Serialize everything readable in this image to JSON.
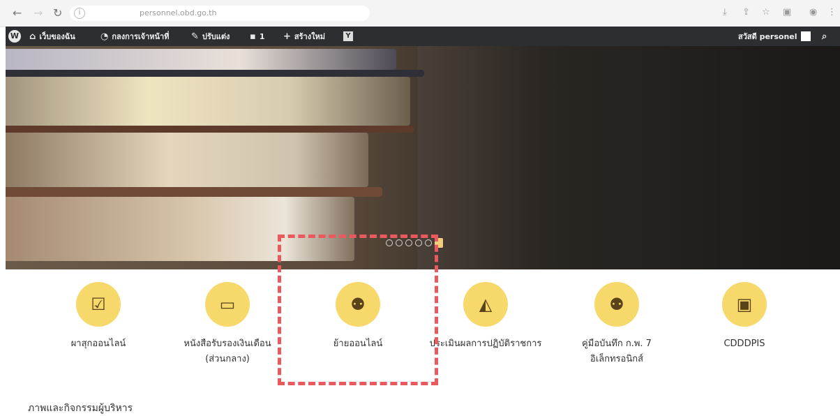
{
  "browser": {
    "url": "personnel.obd.go.th",
    "back_icon": "back-arrow-icon",
    "reload_icon": "reload-icon"
  },
  "admin_bar": {
    "my_site": "เว็บของฉัน",
    "dashboard": "กลงการเจ้าหน้าที่",
    "customize": "ปรับแต่ง",
    "comments_count": "1",
    "new_content": "สร้างใหม่",
    "greeting": "สวัสดี personel"
  },
  "slider": {
    "slide_count": 6,
    "active_index": 6
  },
  "menu": {
    "items": [
      {
        "label": "ผาสุกออนไลน์",
        "label2": "",
        "icon": "calendar-check-icon"
      },
      {
        "label": "หนังสือรับรองเงินเดือน",
        "label2": "(ส่วนกลาง)",
        "icon": "money-icon"
      },
      {
        "label": "ย้ายออนไลน์",
        "label2": "",
        "icon": "users-icon"
      },
      {
        "label": "ประเมินผลการปฏิบัติราชการ",
        "label2": "",
        "icon": "area-chart-icon"
      },
      {
        "label": "คู่มือบันทึก ก.พ. 7",
        "label2": "อิเล็กทรอนิกส์",
        "icon": "users-icon"
      },
      {
        "label": "CDDDPIS",
        "label2": "",
        "icon": "slideshare-icon"
      }
    ]
  },
  "section": {
    "title": "ภาพและกิจกรรมผู้บริหาร"
  },
  "colors": {
    "icon_circle": "#f7d86b",
    "highlight": "#e85a5e",
    "admin_bar": "#2c2e31"
  }
}
